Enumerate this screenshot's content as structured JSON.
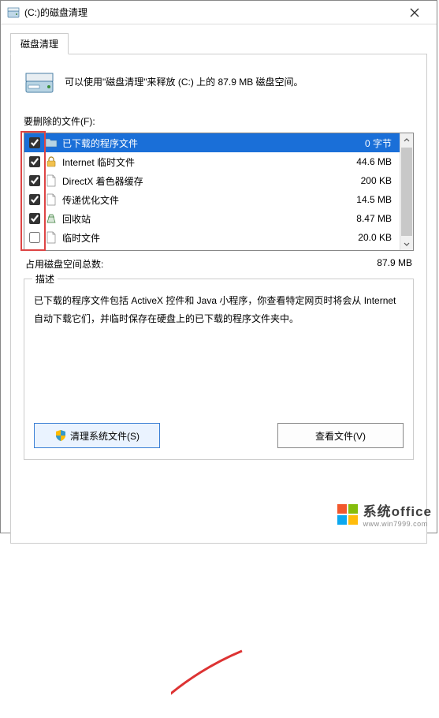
{
  "window": {
    "title": "(C:)的磁盘清理"
  },
  "tab": {
    "label": "磁盘清理"
  },
  "info": {
    "text": "可以使用\"磁盘清理\"来释放  (C:) 上的 87.9 MB 磁盘空间。"
  },
  "files": {
    "label": "要删除的文件(F):",
    "items": [
      {
        "checked": true,
        "name": "已下载的程序文件",
        "size": "0 字节",
        "selected": true,
        "icon": "folder"
      },
      {
        "checked": true,
        "name": "Internet 临时文件",
        "size": "44.6 MB",
        "selected": false,
        "icon": "lock"
      },
      {
        "checked": true,
        "name": "DirectX 着色器缓存",
        "size": "200 KB",
        "selected": false,
        "icon": "file"
      },
      {
        "checked": true,
        "name": "传递优化文件",
        "size": "14.5 MB",
        "selected": false,
        "icon": "file"
      },
      {
        "checked": true,
        "name": "回收站",
        "size": "8.47 MB",
        "selected": false,
        "icon": "recycle"
      },
      {
        "checked": false,
        "name": "临时文件",
        "size": "20.0 KB",
        "selected": false,
        "icon": "file"
      }
    ]
  },
  "total": {
    "label": "占用磁盘空间总数:",
    "value": "87.9 MB"
  },
  "desc": {
    "legend": "描述",
    "text": "已下载的程序文件包括 ActiveX 控件和 Java 小程序，你查看特定网页时将会从 Internet 自动下载它们，并临时保存在硬盘上的已下载的程序文件夹中。"
  },
  "buttons": {
    "clean_system": "清理系统文件(S)",
    "view_files": "查看文件(V)"
  },
  "watermark": {
    "text": "系统office",
    "sub": "www.win7999.com"
  }
}
